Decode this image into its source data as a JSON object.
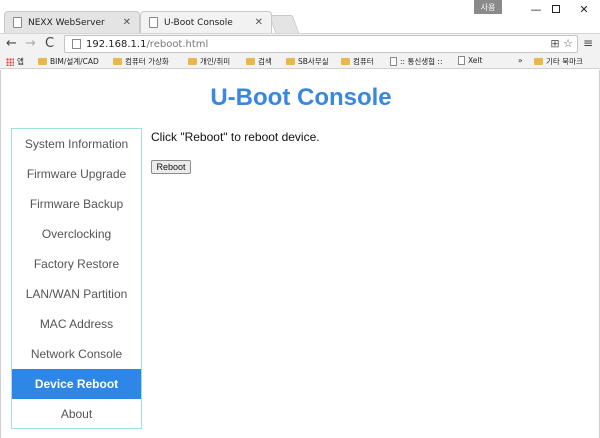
{
  "window": {
    "user_badge": "사용",
    "minimize": "—",
    "close": "✕"
  },
  "tabs": [
    {
      "label": "NEXX WebServer",
      "close": "✕"
    },
    {
      "label": "U-Boot Console",
      "close": "✕"
    }
  ],
  "toolbar": {
    "back": "←",
    "forward": "→",
    "reload": "C",
    "url_host": "192.168.1.1",
    "url_path": "/reboot.html",
    "translate_icon": "⊞",
    "star": "☆",
    "menu": "≡"
  },
  "bookmarks": {
    "items": [
      "앱",
      "BIM/설계/CAD",
      "컴퓨터 가상화",
      "개인/취미",
      "검색",
      "SB사무실",
      "컴퓨터",
      ":: 통신생협 ::",
      "Xelt"
    ],
    "overflow": "»",
    "other": "기타 북마크"
  },
  "page": {
    "title": "U-Boot Console",
    "nav": [
      "System Information",
      "Firmware Upgrade",
      "Firmware Backup",
      "Overclocking",
      "Factory Restore",
      "LAN/WAN Partition",
      "MAC Address",
      "Network Console",
      "Device Reboot",
      "About"
    ],
    "active_index": 8,
    "instruction": "Click \"Reboot\" to reboot device.",
    "reboot_button": "Reboot"
  },
  "colors": {
    "title": "#3a87e0",
    "active_nav": "#2e86e6",
    "nav_border": "#9fe0dc"
  }
}
